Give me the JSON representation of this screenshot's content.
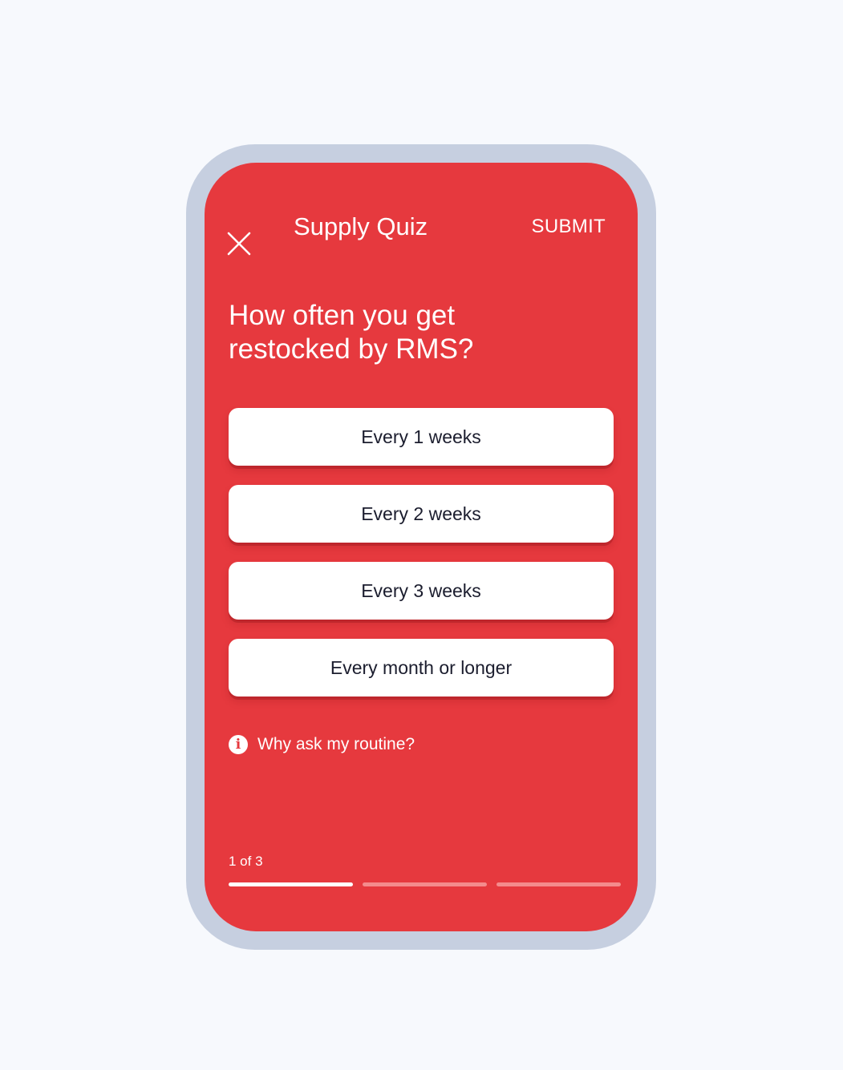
{
  "header": {
    "title": "Supply Quiz",
    "submit_label": "SUBMIT",
    "close_icon": "close-icon"
  },
  "question": {
    "text": "How often you get restocked by RMS?"
  },
  "options": [
    {
      "label": "Every 1 weeks"
    },
    {
      "label": "Every 2 weeks"
    },
    {
      "label": "Every 3 weeks"
    },
    {
      "label": "Every month or longer"
    }
  ],
  "info": {
    "icon": "info-icon",
    "glyph": "i",
    "label": "Why ask my routine?"
  },
  "progress": {
    "label": "1 of 3",
    "current": 1,
    "total": 3
  },
  "colors": {
    "background": "#f7f9fd",
    "frame": "#c6cfe0",
    "screen": "#e6393e",
    "option_bg": "#ffffff",
    "option_text": "#1b1d2e",
    "progress_inactive": "#f48b8c",
    "progress_active": "#ffffff"
  }
}
